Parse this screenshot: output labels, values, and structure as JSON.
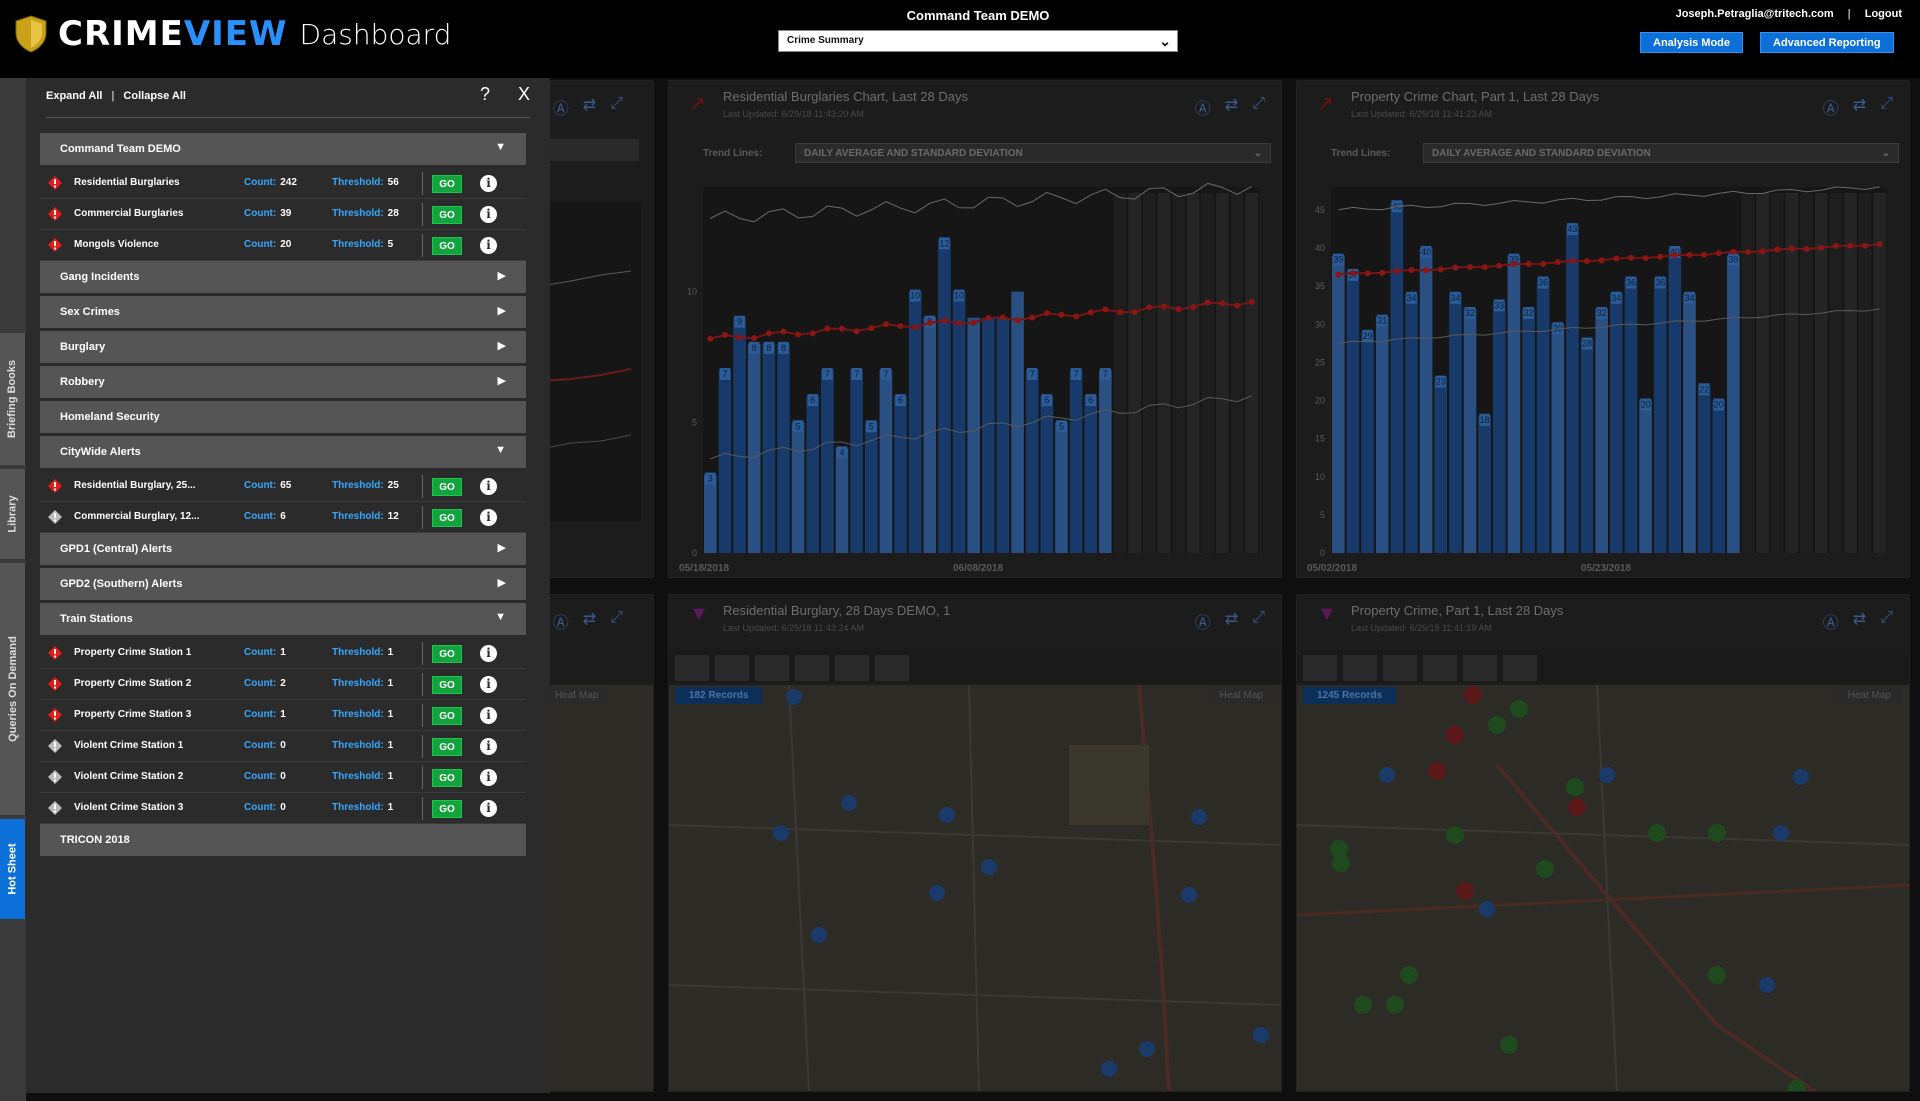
{
  "header": {
    "brand_part1": "CRIME",
    "brand_part2": "VIEW",
    "brand_suffix": "Dashboard",
    "center_title": "Command Team DEMO",
    "dashboard_select": "Crime Summary",
    "user": "Joseph.Petraglia@tritech.com",
    "separator": "|",
    "logout": "Logout",
    "analysis_mode": "Analysis Mode",
    "advanced_reporting": "Advanced Reporting"
  },
  "vtabs": [
    {
      "label": "Briefing Books",
      "active": false
    },
    {
      "label": "Library",
      "active": false
    },
    {
      "label": "Queries On Demand",
      "active": false
    },
    {
      "label": "Hot Sheet",
      "active": true
    }
  ],
  "hotsheet": {
    "expand_all": "Expand All",
    "collapse_all": "Collapse All",
    "divider": "|",
    "help": "?",
    "close": "X",
    "count_label": "Count:",
    "threshold_label": "Threshold:",
    "go_label": "GO",
    "info_label": "i",
    "items": [
      {
        "type": "group",
        "label": "Command Team DEMO",
        "arrow": "▼"
      },
      {
        "type": "row",
        "name": "Residential Burglaries",
        "count": "242",
        "threshold": "56",
        "alert": true
      },
      {
        "type": "row",
        "name": "Commercial Burglaries",
        "count": "39",
        "threshold": "28",
        "alert": true
      },
      {
        "type": "row",
        "name": "Mongols Violence",
        "count": "20",
        "threshold": "5",
        "alert": true
      },
      {
        "type": "group",
        "label": "Gang Incidents",
        "arrow": "▶"
      },
      {
        "type": "group",
        "label": "Sex Crimes",
        "arrow": "▶"
      },
      {
        "type": "group",
        "label": "Burglary",
        "arrow": "▶"
      },
      {
        "type": "group",
        "label": "Robbery",
        "arrow": "▶"
      },
      {
        "type": "group",
        "label": "Homeland Security",
        "arrow": ""
      },
      {
        "type": "group",
        "label": "CityWide Alerts",
        "arrow": "▼"
      },
      {
        "type": "row",
        "name": "Residential Burglary, 25...",
        "count": "65",
        "threshold": "25",
        "alert": true
      },
      {
        "type": "row",
        "name": "Commercial Burglary, 12...",
        "count": "6",
        "threshold": "12",
        "alert": false
      },
      {
        "type": "group",
        "label": "GPD1 (Central) Alerts",
        "arrow": "▶"
      },
      {
        "type": "group",
        "label": "GPD2 (Southern) Alerts",
        "arrow": "▶"
      },
      {
        "type": "group",
        "label": "Train Stations",
        "arrow": "▼"
      },
      {
        "type": "row",
        "name": "Property Crime Station 1",
        "count": "1",
        "threshold": "1",
        "alert": true
      },
      {
        "type": "row",
        "name": "Property Crime Station 2",
        "count": "2",
        "threshold": "1",
        "alert": true
      },
      {
        "type": "row",
        "name": "Property Crime Station 3",
        "count": "1",
        "threshold": "1",
        "alert": true
      },
      {
        "type": "row",
        "name": "Violent Crime Station 1",
        "count": "0",
        "threshold": "1",
        "alert": false
      },
      {
        "type": "row",
        "name": "Violent Crime Station 2",
        "count": "0",
        "threshold": "1",
        "alert": false
      },
      {
        "type": "row",
        "name": "Violent Crime Station 3",
        "count": "0",
        "threshold": "1",
        "alert": false
      },
      {
        "type": "group",
        "label": "TRICON 2018",
        "arrow": ""
      }
    ]
  },
  "panels": {
    "chart1": {
      "title": "Residential Burglaries  Chart, Last 28 Days",
      "updated": "Last Updated: 6/29/18 11:43:20 AM",
      "trend_label": "Trend Lines:",
      "trend_value": "DAILY AVERAGE AND STANDARD DEVIATION",
      "x_start": "05/18/2018",
      "x_mid": "06/08/2018"
    },
    "chart2": {
      "title": "Property Crime Chart, Part 1, Last 28 Days",
      "updated": "Last Updated: 6/29/18 11:41:23 AM",
      "trend_label": "Trend Lines:",
      "trend_value": "DAILY AVERAGE AND STANDARD DEVIATION",
      "x_start": "05/02/2018",
      "x_mid": "05/23/2018"
    },
    "map1": {
      "title": "Residential Burglary, 28 Days DEMO, 1",
      "updated": "Last Updated: 6/29/18 11:43:24 AM",
      "records": "182 Records",
      "heat": "Heat Map"
    },
    "map2": {
      "title": "Property Crime, Part 1, Last 28 Days",
      "updated": "Last Updated: 6/29/18 11:41:19 AM",
      "records": "1245 Records",
      "heat": "Heat Map"
    },
    "left_heat": "Heat Map"
  },
  "chart_data": [
    {
      "type": "bar",
      "title": "Residential Burglaries  Chart, Last 28 Days",
      "ylim": [
        0,
        14
      ],
      "yticks": [
        "0",
        "5",
        "10"
      ],
      "values": [
        3,
        7,
        9,
        8,
        8,
        8,
        5,
        6,
        7,
        4,
        7,
        5,
        7,
        6,
        10,
        9,
        12,
        10,
        9,
        9,
        9,
        10,
        7,
        6,
        5,
        7,
        6,
        7
      ],
      "data_labels": [
        "3",
        "7",
        "9",
        "8",
        "8",
        "8",
        "5",
        "6",
        "7",
        "4",
        "7",
        "5",
        "7",
        "6",
        "10",
        "9",
        "12",
        "10",
        "",
        "",
        "",
        "",
        "7",
        "6",
        "5",
        "7",
        "6",
        "7"
      ]
    },
    {
      "type": "bar",
      "title": "Property Crime Chart, Part 1, Last 28 Days",
      "ylim": [
        0,
        48
      ],
      "yticks": [
        "0",
        "5",
        "10",
        "15",
        "20",
        "25",
        "30",
        "35",
        "40",
        "45"
      ],
      "values": [
        39,
        37,
        29,
        31,
        46,
        34,
        40,
        23,
        34,
        32,
        18,
        33,
        39,
        32,
        36,
        30,
        43,
        28,
        32,
        34,
        36,
        20,
        36,
        40,
        34,
        22,
        20,
        39
      ],
      "data_labels": [
        "39",
        "37",
        "29",
        "31",
        "46",
        "34",
        "40",
        "23",
        "34",
        "32",
        "18",
        "33",
        "39",
        "32",
        "36",
        "30",
        "43",
        "28",
        "32",
        "34",
        "36",
        "20",
        "36",
        "40",
        "34",
        "22",
        "20",
        "39"
      ]
    }
  ]
}
